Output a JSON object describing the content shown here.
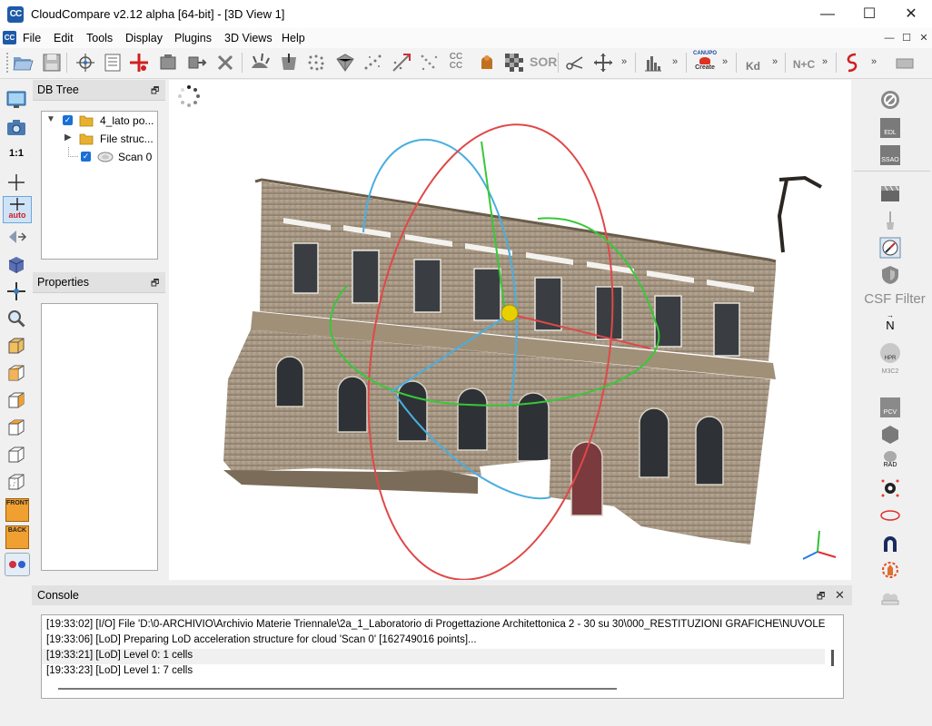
{
  "window": {
    "title": "CloudCompare v2.12 alpha [64-bit] - [3D View 1]",
    "logo_text": "CC",
    "minimize_glyph": "—",
    "maximize_glyph": "☐",
    "close_glyph": "✕"
  },
  "menu": {
    "items": [
      "File",
      "Edit",
      "Tools",
      "Display",
      "Plugins",
      "3D Views",
      "Help"
    ]
  },
  "toolbar": {
    "cccc_label": "CC\nCC",
    "sor_label": "SOR",
    "canupo_label": "CANUPO",
    "create_label": "Create",
    "kd_label": "Kd",
    "nc_label": "N+C",
    "more_glyph": "»"
  },
  "left_toolbar": {
    "one_to_one_label": "1:1",
    "auto_label": "auto",
    "front_label": "FRONT",
    "back_label": "BACK"
  },
  "db_tree": {
    "title": "DB Tree",
    "items": [
      {
        "label": "4_lato po...",
        "checked": true,
        "type": "folder",
        "expanded": true
      },
      {
        "label": "File struc...",
        "checked": null,
        "type": "folder",
        "expanded": false
      },
      {
        "label": "Scan 0",
        "checked": true,
        "type": "cloud"
      }
    ]
  },
  "properties": {
    "title": "Properties"
  },
  "right_toolbar": {
    "edl_label": "EDL",
    "ssao_label": "SSAO",
    "csf_filter_label": "CSF Filter",
    "n_label": "N",
    "hpr_label": "HPR",
    "m3c2_label": "M3C2",
    "pcv_label": "PCV",
    "rad_label": "RAD"
  },
  "console": {
    "title": "Console",
    "lines": [
      "[19:33:02] [I/O] File 'D:\\0-ARCHIVIO\\Archivio Materie Triennale\\2a_1_Laboratorio di Progettazione Architettonica 2 - 30 su 30\\000_RESTITUZIONI GRAFICHE\\NUVOLE",
      "[19:33:06] [LoD] Preparing LoD acceleration structure for cloud 'Scan 0' [162749016 points]...",
      "[19:33:21] [LoD] Level 0: 1 cells",
      "[19:33:23] [LoD] Level 1: 7 cells"
    ]
  },
  "colors": {
    "accent": "#1e5aa8",
    "x_axis": "#e03030",
    "y_axis": "#30c030",
    "z_axis": "#2080e0",
    "rotation_ring_blue": "#49aee0",
    "rotation_ring_red": "#e04848",
    "rotation_ring_green": "#38c838",
    "pivot": "#e8d000"
  }
}
